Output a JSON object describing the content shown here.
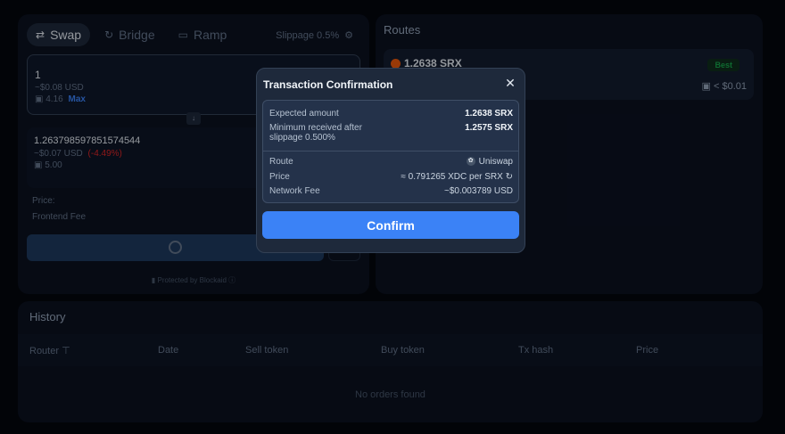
{
  "swap": {
    "tabs": [
      {
        "label": "Swap",
        "icon": "swap-arrows-icon"
      },
      {
        "label": "Bridge",
        "icon": "bridge-cycle-icon"
      },
      {
        "label": "Ramp",
        "icon": "card-icon"
      }
    ],
    "slippage_label": "Slippage 0.5%",
    "sell": {
      "amount": "1",
      "usd": "~$0.08 USD",
      "balance": "4.16",
      "max_label": "Max"
    },
    "buy": {
      "amount": "1.263798597851574544",
      "usd": "~$0.07 USD",
      "pct": "(-4.49%)",
      "balance": "5.00"
    },
    "price_label": "Price:",
    "frontend_fee_label": "Frontend Fee",
    "protected_label": "Protected by Blockaid"
  },
  "routes": {
    "title": "Routes",
    "best_route": {
      "amount": "1.2638 SRX",
      "badge": "Best",
      "fee": "< $0.01"
    }
  },
  "history": {
    "title": "History",
    "columns": [
      "Router",
      "Date",
      "Sell token",
      "Buy token",
      "Tx hash",
      "Price"
    ],
    "empty_text": "No orders found"
  },
  "modal": {
    "title": "Transaction Confirmation",
    "rows": {
      "expected_amount": {
        "label": "Expected amount",
        "value": "1.2638 SRX"
      },
      "minimum_received": {
        "label_line1": "Minimum received after",
        "label_line2": "slippage 0.500%",
        "value": "1.2575 SRX"
      },
      "route": {
        "label": "Route",
        "value": "Uniswap"
      },
      "price": {
        "label": "Price",
        "value": "≈ 0.791265 XDC per SRX"
      },
      "network_fee": {
        "label": "Network Fee",
        "value": "~$0.003789 USD"
      }
    },
    "confirm_label": "Confirm"
  },
  "colors": {
    "accent": "#3b82f6",
    "best": "#16a34a",
    "negative": "#dc2626"
  }
}
